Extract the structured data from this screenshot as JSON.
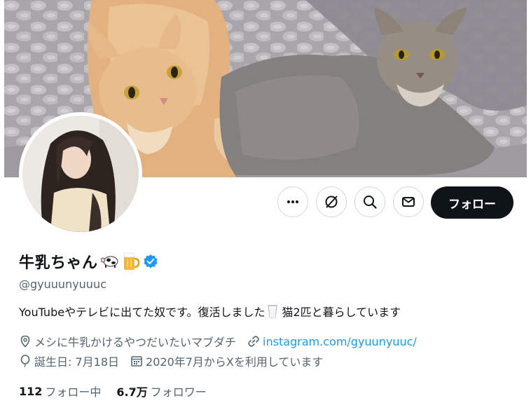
{
  "profile": {
    "display_name": "牛乳ちゃん",
    "name_emoji": [
      "cow-emoji",
      "beer-mug-emoji"
    ],
    "handle": "@gyuuunyuuuc",
    "bio_before": "YouTubeやテレビに出てた奴です。復活しました",
    "bio_after": "猫2匹と暮らしています",
    "location": "メシに牛乳かけるやつだいたいマブダチ",
    "website": "instagram.com/gyuunyuuc/",
    "birthday": "誕生日: 7月18日",
    "joined": "2020年7月からXを利用しています",
    "following_count": "112",
    "following_label": "フォロー中",
    "followers_count": "6.7万",
    "followers_label": "フォロワー",
    "verified": true
  },
  "actions": {
    "more_icon": "more-icon",
    "grok_icon": "grok-icon",
    "search_icon": "search-icon",
    "message_icon": "message-icon",
    "follow_label": "フォロー"
  },
  "colors": {
    "accent": "#1d9bf0",
    "text_primary": "#0f1419",
    "text_secondary": "#536471",
    "button_dark": "#0f1419",
    "border": "#cfd9de"
  }
}
